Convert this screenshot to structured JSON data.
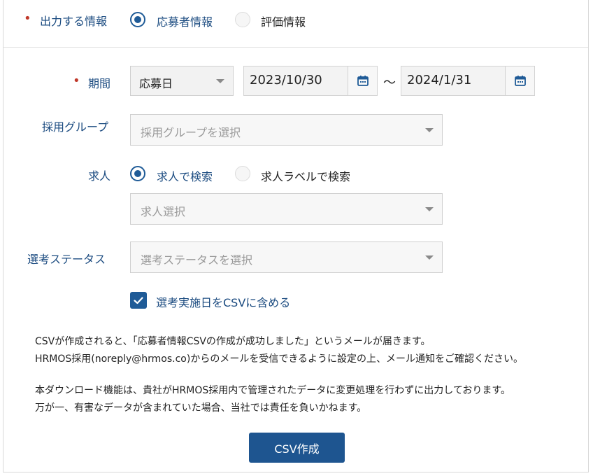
{
  "info_section": {
    "label": "出力する情報",
    "options": [
      {
        "label": "応募者情報",
        "selected": true
      },
      {
        "label": "評価情報",
        "selected": false
      }
    ]
  },
  "period": {
    "label": "期間",
    "type_select": "応募日",
    "start_date": "2023/10/30",
    "separator": "〜",
    "end_date": "2024/1/31"
  },
  "group": {
    "label": "採用グループ",
    "placeholder": "採用グループを選択"
  },
  "job": {
    "label": "求人",
    "options": [
      {
        "label": "求人で検索",
        "selected": true
      },
      {
        "label": "求人ラベルで検索",
        "selected": false
      }
    ],
    "placeholder": "求人選択"
  },
  "status": {
    "label": "選考ステータス",
    "placeholder": "選考ステータスを選択"
  },
  "include_date": {
    "label": "選考実施日をCSVに含める",
    "checked": true
  },
  "notes": [
    "CSVが作成されると、「応募者情報CSVの作成が成功しました」というメールが届きます。",
    "HRMOS採用(noreply@hrmos.co)からのメールを受信できるように設定の上、メール通知をご確認ください。",
    "本ダウンロード機能は、貴社がHRMOS採用内で管理されたデータに変更処理を行わずに出力しております。",
    "万が一、有害なデータが含まれていた場合、当社では責任を負いかねます。"
  ],
  "submit_label": "CSV作成",
  "colors": {
    "accent": "#1e5590",
    "label": "#1b4b80",
    "required": "#c0392b"
  }
}
